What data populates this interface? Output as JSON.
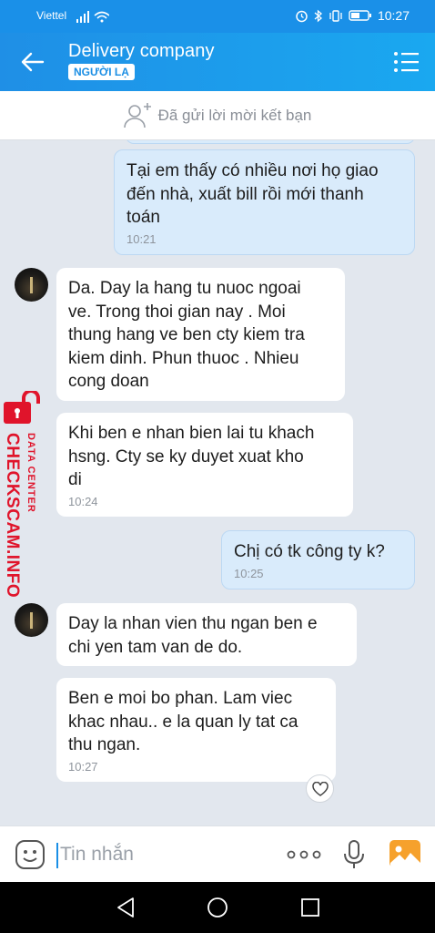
{
  "status_bar": {
    "carrier": "Viettel",
    "time": "10:27"
  },
  "header": {
    "title": "Delivery company",
    "badge": "NGƯỜI LẠ"
  },
  "friend_bar": {
    "text": "Đã gửi lời mời kết bạn"
  },
  "messages": [
    {
      "direction": "out",
      "lines": [
        "Tại em thấy có nhiều nơi họ giao",
        "đến nhà, xuất bill rồi mới thanh",
        "toán"
      ],
      "time": "10:21"
    },
    {
      "direction": "in",
      "lines": [
        "Da. Day la hang tu nuoc ngoai",
        "ve. Trong thoi gian nay . Moi",
        "thung hang ve ben cty kiem tra",
        "kiem dinh. Phun thuoc . Nhieu",
        "cong doan"
      ],
      "time": ""
    },
    {
      "direction": "in",
      "lines": [
        "Khi ben e nhan bien lai tu khach",
        "hsng. Cty se ky duyet xuat kho",
        "di"
      ],
      "time": "10:24"
    },
    {
      "direction": "out",
      "lines": [
        "Chị có tk công ty k?"
      ],
      "time": "10:25"
    },
    {
      "direction": "in",
      "lines": [
        "Day la nhan vien thu ngan ben e",
        "chi yen tam van de do."
      ],
      "time": ""
    },
    {
      "direction": "in",
      "lines": [
        "Ben e moi bo phan. Lam viec",
        "khac nhau.. e la quan ly tat ca",
        "thu ngan."
      ],
      "time": "10:27"
    }
  ],
  "watermark": {
    "line1": "DATA CENTER",
    "line2": "CHECKSCAM.INFO"
  },
  "input": {
    "placeholder": "Tin nhắn"
  },
  "colors": {
    "header": "#1a90e8",
    "outgoing_bubble": "#d9ebfb",
    "incoming_bubble": "#ffffff",
    "chat_background": "#e2e7ee",
    "watermark": "#e0142b"
  }
}
